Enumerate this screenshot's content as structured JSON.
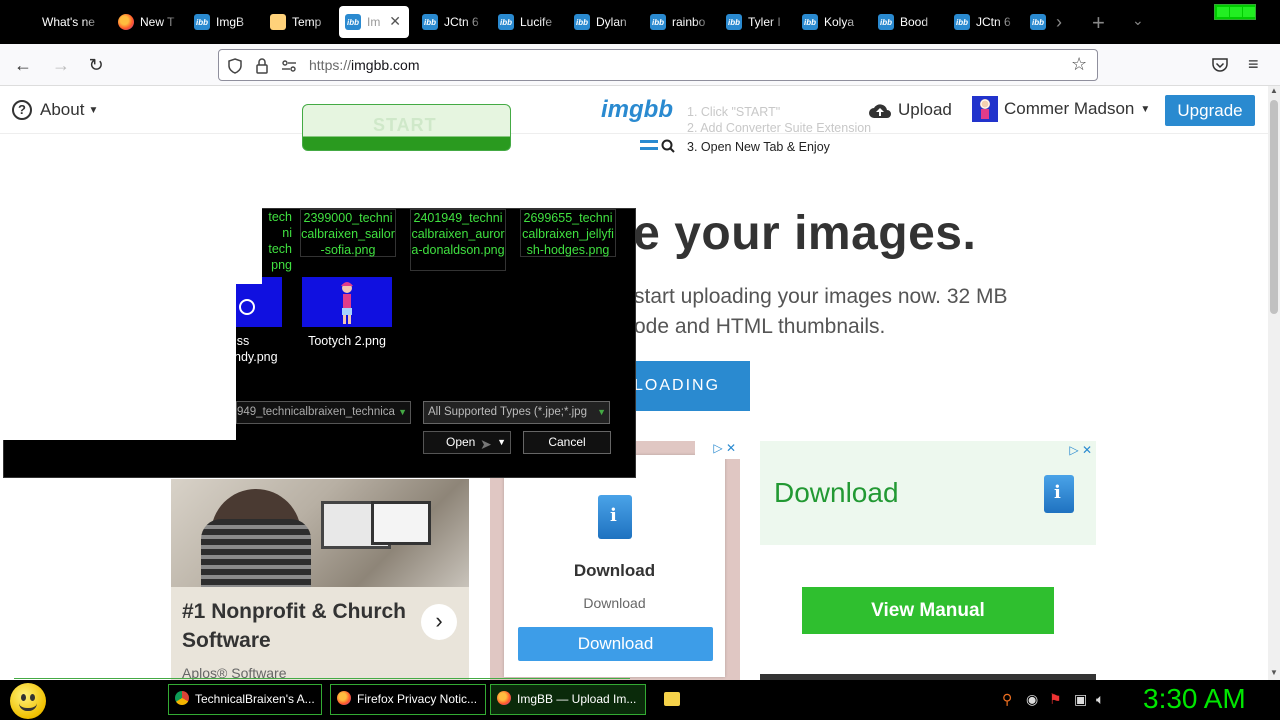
{
  "tabs": [
    {
      "label": "What's ne",
      "icon": "none"
    },
    {
      "label": "New T",
      "icon": "firefox-icon"
    },
    {
      "label": "ImgB",
      "icon": "imgbb-icon"
    },
    {
      "label": "Temp",
      "icon": "mail-icon"
    },
    {
      "label": "Im",
      "icon": "imgbb-icon",
      "active": true
    },
    {
      "label": "JCtn 6",
      "icon": "imgbb-icon"
    },
    {
      "label": "Lucife",
      "icon": "imgbb-icon"
    },
    {
      "label": "Dylan",
      "icon": "imgbb-icon"
    },
    {
      "label": "rainbo",
      "icon": "imgbb-icon"
    },
    {
      "label": "Tyler I",
      "icon": "imgbb-icon"
    },
    {
      "label": "Kolya",
      "icon": "imgbb-icon"
    },
    {
      "label": "Bood",
      "icon": "imgbb-icon"
    },
    {
      "label": "JCtn 6",
      "icon": "imgbb-icon"
    }
  ],
  "browser": {
    "url_scheme": "https://",
    "url_host": "imgbb.com"
  },
  "site": {
    "about": "About",
    "logo": "imgbb",
    "upload": "Upload",
    "user": "Commer Madson",
    "upgrade": "Upgrade",
    "start_button": "START",
    "steps": [
      "1.  Click \"START\"",
      "2.  Add Converter Suite Extension",
      "3.  Open New Tab & Enjoy"
    ],
    "hero_title": "re your images.",
    "hero_sub_1": "start uploading your images now. 32 MB",
    "hero_sub_2": "ode and HTML thumbnails.",
    "start_upload": "LOADING"
  },
  "ads": {
    "left_title": "#1 Nonprofit & Church Software",
    "left_brand": "Aplos® Software",
    "mid_title": "Download",
    "mid_sub": "Download",
    "mid_button": "Download",
    "right_title": "Download",
    "right_button": "View Manual"
  },
  "dialog": {
    "files_row1": [
      "techni tech png",
      "2399000_technicalbraixen_sailor-sofia.png",
      "2401949_technicalbraixen_aurora-donaldson.png",
      "2699655_technicalbraixen_jellyfish-hodges.png"
    ],
    "file_partial_1": "iss",
    "file_partial_2": "ndy.png",
    "file_tootych": "Tootych 2.png",
    "filename_value": "949_technicalbraixen_technica",
    "filter_value": "All Supported Types (*.jpe;*.jpg",
    "open": "Open",
    "cancel": "Cancel"
  },
  "taskbar": {
    "tasks": [
      {
        "label": "TechnicalBraixen's A...",
        "icon": "chrome-icon"
      },
      {
        "label": "Firefox Privacy Notic...",
        "icon": "firefox-icon"
      },
      {
        "label": "ImgBB — Upload Im...",
        "icon": "firefox-icon",
        "active": true
      }
    ],
    "clock": "3:30 AM"
  }
}
